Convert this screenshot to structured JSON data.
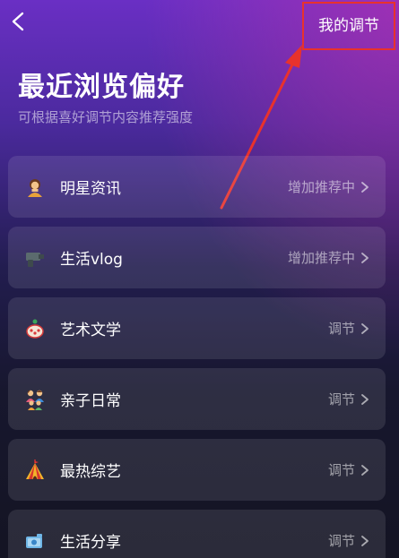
{
  "header": {
    "my_adjust_label": "我的调节"
  },
  "page": {
    "title": "最近浏览偏好",
    "subtitle": "可根据喜好调节内容推荐强度"
  },
  "items": [
    {
      "icon": "celebrity-icon",
      "label": "明星资讯",
      "status": "增加推荐中"
    },
    {
      "icon": "camera-icon",
      "label": "生活vlog",
      "status": "增加推荐中"
    },
    {
      "icon": "art-icon",
      "label": "艺术文学",
      "status": "调节"
    },
    {
      "icon": "family-icon",
      "label": "亲子日常",
      "status": "调节"
    },
    {
      "icon": "circus-tent-icon",
      "label": "最热综艺",
      "status": "调节"
    },
    {
      "icon": "share-icon",
      "label": "生活分享",
      "status": "调节"
    }
  ],
  "colors": {
    "annotation_red": "#e8322c",
    "background_top": "#6a2fc4",
    "background_bottom": "#141423"
  }
}
